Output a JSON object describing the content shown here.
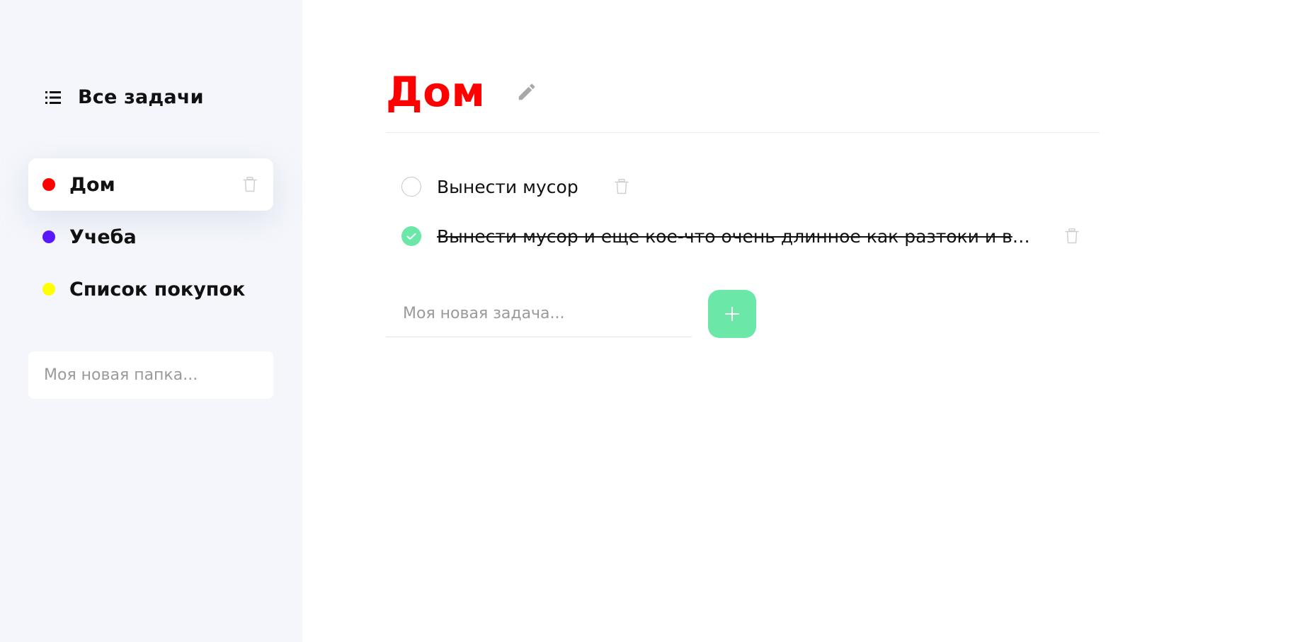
{
  "sidebar": {
    "all_tasks_label": "Все задачи",
    "folders": [
      {
        "label": "Дом",
        "color": "#FF0000",
        "active": true
      },
      {
        "label": "Учеба",
        "color": "#5A18FF",
        "active": false
      },
      {
        "label": "Список покупок",
        "color": "#FFFF00",
        "active": false
      }
    ],
    "new_folder_placeholder": "Моя новая папка..."
  },
  "main": {
    "title": "Дом",
    "title_color": "#FF0000",
    "tasks": [
      {
        "text": "Вынести мусор",
        "completed": false
      },
      {
        "text": "Вынести мусор и еще кое-что очень длинное как разтоки и вы...",
        "completed": true
      }
    ],
    "new_task_placeholder": "Моя новая задача..."
  },
  "colors": {
    "sidebar_bg": "#F4F6FB",
    "accent_green": "#6BE8A7",
    "icon_gray": "#9E9E9E"
  }
}
